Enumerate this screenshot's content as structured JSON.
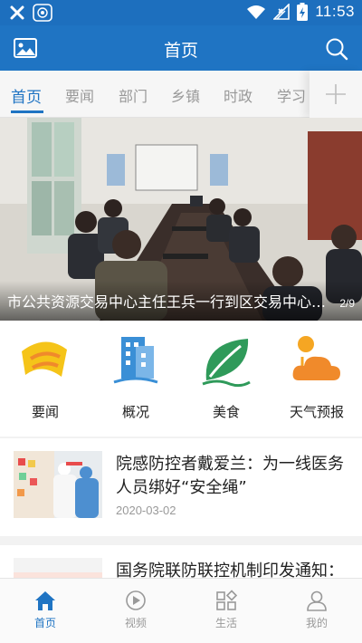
{
  "status_bar": {
    "time": "11:53"
  },
  "app_bar": {
    "title": "首页",
    "left_icon": "image-icon",
    "right_icon": "search-icon"
  },
  "tabs": [
    {
      "label": "首页",
      "active": true
    },
    {
      "label": "要闻"
    },
    {
      "label": "部门"
    },
    {
      "label": "乡镇"
    },
    {
      "label": "时政"
    },
    {
      "label": "学习"
    }
  ],
  "banner": {
    "caption": "市公共资源交易中心主任王兵一行到区交易中心调研",
    "pager": "2/9"
  },
  "quick_links": [
    {
      "label": "要闻",
      "icon": "news-icon"
    },
    {
      "label": "概况",
      "icon": "building-icon"
    },
    {
      "label": "美食",
      "icon": "leaf-icon"
    },
    {
      "label": "天气预报",
      "icon": "weather-icon"
    }
  ],
  "news": [
    {
      "title": "院感防控者戴爱兰：为一线医务人员绑好“安全绳”",
      "date": "2020-03-02"
    },
    {
      "title": "国务院联防联控机制印发通知：进一步指导各地落实分"
    }
  ],
  "bottom_nav": [
    {
      "label": "首页",
      "icon": "home-icon",
      "active": true
    },
    {
      "label": "视频",
      "icon": "play-icon"
    },
    {
      "label": "生活",
      "icon": "grid-icon"
    },
    {
      "label": "我的",
      "icon": "user-icon"
    }
  ],
  "colors": {
    "primary": "#1f74c3",
    "accent_orange": "#f08a2b",
    "accent_yellow": "#f5c419",
    "accent_green": "#2f9a5a",
    "accent_blue": "#3a8fd6"
  }
}
